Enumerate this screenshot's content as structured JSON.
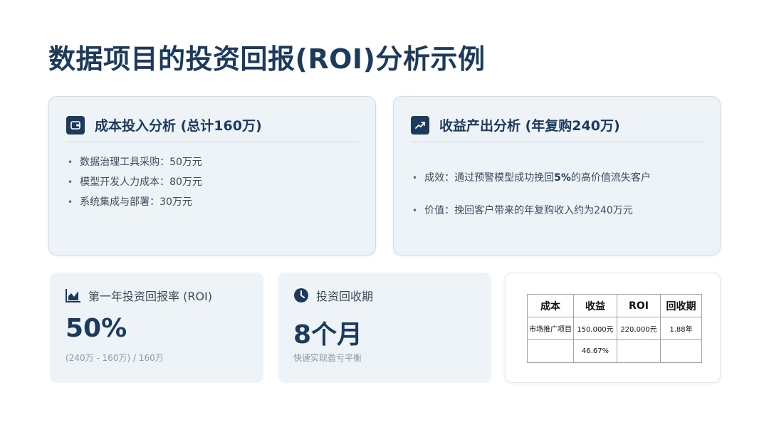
{
  "page": {
    "title": "数据项目的投资回报(ROI)分析示例"
  },
  "cost_card": {
    "icon": "wallet-icon",
    "title": "成本投入分析 (总计160万)",
    "items": [
      "数据治理工具采购：50万元",
      "模型开发人力成本：80万元",
      "系统集成与部署：30万元"
    ]
  },
  "revenue_card": {
    "icon": "trending-up-icon",
    "title": "收益产出分析 (年复购240万)",
    "item1_prefix": "成效：通过预警模型成功挽回",
    "item1_highlight": "5%",
    "item1_suffix": "的高价值流失客户",
    "item2": "价值：挽回客户带来的年复购收入约为240万元"
  },
  "roi_stat": {
    "icon": "bar-chart-icon",
    "label": "第一年投资回报率 (ROI)",
    "value": "50%",
    "note": "(240万 - 160万) / 160万"
  },
  "payback_stat": {
    "icon": "clock-icon",
    "label": "投资回收期",
    "value": "8个月",
    "note": "快速实现盈亏平衡"
  },
  "roi_table": {
    "headers": [
      "成本",
      "收益",
      "ROI",
      "回收期"
    ],
    "row1": [
      "市场推广项目",
      "150,000元",
      "220,000元",
      "1.88年"
    ],
    "row2": [
      "",
      "46.67%",
      "",
      ""
    ]
  },
  "colors": {
    "primary": "#1b3a5c",
    "card_bg": "#eef3f8"
  }
}
